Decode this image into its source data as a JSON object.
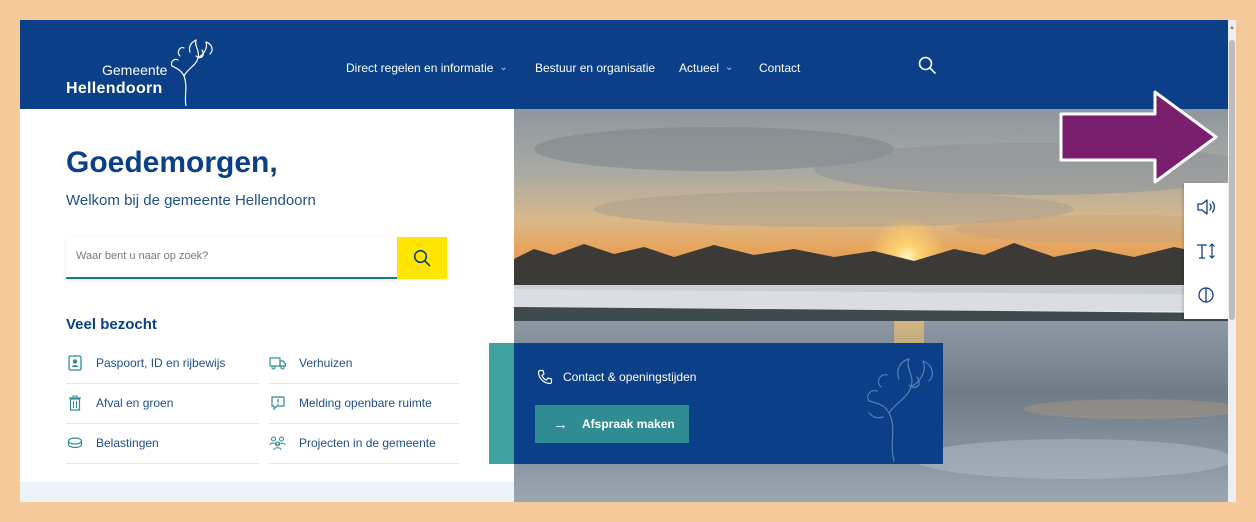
{
  "logo": {
    "line1": "Gemeente",
    "line2": "Hellendoorn"
  },
  "nav": [
    {
      "label": "Direct regelen en informatie",
      "has_dropdown": true
    },
    {
      "label": "Bestuur en organisatie",
      "has_dropdown": false
    },
    {
      "label": "Actueel",
      "has_dropdown": true
    },
    {
      "label": "Contact",
      "has_dropdown": false
    }
  ],
  "hero": {
    "greeting": "Goedemorgen,",
    "welcome": "Welkom bij de gemeente Hellendoorn",
    "search_placeholder": "Waar bent u naar op zoek?"
  },
  "veel_bezocht": {
    "title": "Veel bezocht",
    "items": [
      {
        "label": "Paspoort, ID en rijbewijs",
        "icon": "id-card-icon"
      },
      {
        "label": "Verhuizen",
        "icon": "truck-icon"
      },
      {
        "label": "Afval en groen",
        "icon": "trash-icon"
      },
      {
        "label": "Melding openbare ruimte",
        "icon": "alert-bubble-icon"
      },
      {
        "label": "Belastingen",
        "icon": "coins-icon"
      },
      {
        "label": "Projecten in de gemeente",
        "icon": "people-icon"
      }
    ]
  },
  "card": {
    "contact_label": "Contact & openingstijden",
    "button_label": "Afspraak maken"
  },
  "toolbar": [
    {
      "icon": "speaker-icon"
    },
    {
      "icon": "text-size-icon"
    },
    {
      "icon": "contrast-icon"
    }
  ],
  "colors": {
    "brand_blue": "#0b3f87",
    "accent_yellow": "#ffe600",
    "teal": "#2f8c93",
    "annotation_arrow": "#7a1e6e",
    "frame_border": "#f5c99a"
  }
}
